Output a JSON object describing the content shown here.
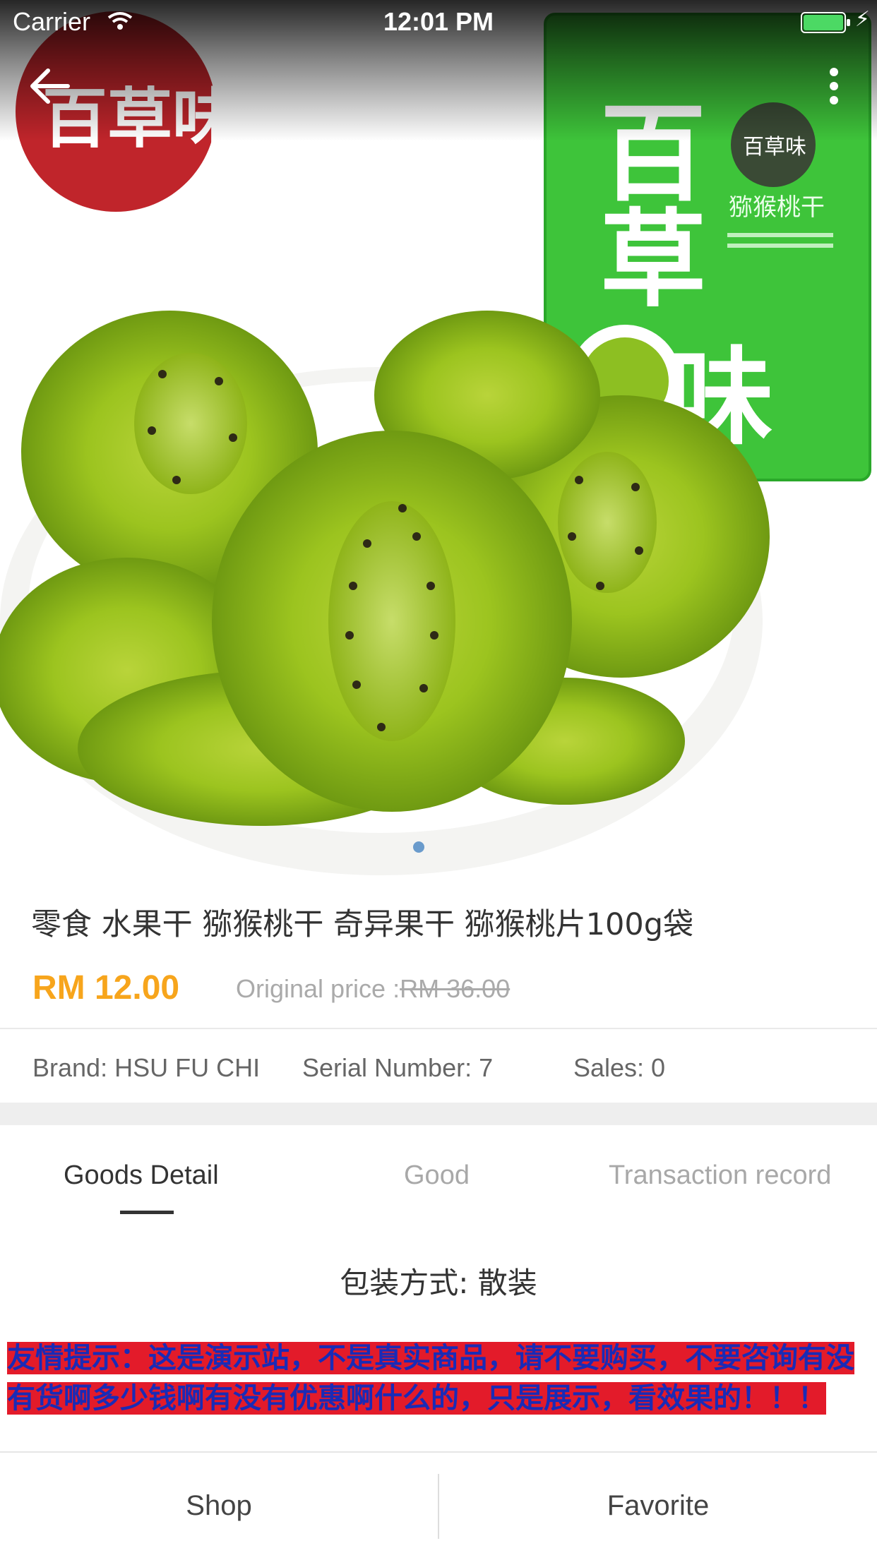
{
  "status_bar": {
    "carrier": "Carrier",
    "time": "12:01 PM"
  },
  "nav": {
    "back_icon": "back-arrow-icon",
    "more_icon": "more-vertical-icon"
  },
  "hero": {
    "brand_logo_text": "百草味",
    "package_text": "猕猴桃干",
    "image_count": 1,
    "active_index": 0
  },
  "product": {
    "title": "零食 水果干 猕猴桃干 奇异果干 猕猴桃片100g袋",
    "price": "RM 12.00",
    "original_price_label": "Original price :",
    "original_price_value": "RM 36.00",
    "brand": "Brand: HSU FU CHI",
    "serial": "Serial Number: 7",
    "sales": "Sales: 0"
  },
  "tabs": [
    {
      "label": "Goods Detail",
      "active": true
    },
    {
      "label": "Good",
      "active": false
    },
    {
      "label": "Transaction record",
      "active": false
    }
  ],
  "detail": {
    "packaging": "包装方式: 散装",
    "notice_line1": "友情提示：这是演示站，不是真实商品，请不要购买，不要咨询有没",
    "notice_line2": "有货啊多少钱啊有没有优惠啊什么的，只是展示，看效果的！！！"
  },
  "bottom_bar": {
    "shop_label": "Shop",
    "favorite_label": "Favorite"
  },
  "colors": {
    "price": "#f7a51c",
    "notice_text": "#1a2bb6",
    "notice_bg": "#e31b2a",
    "indicator": "#6a9bcc"
  }
}
